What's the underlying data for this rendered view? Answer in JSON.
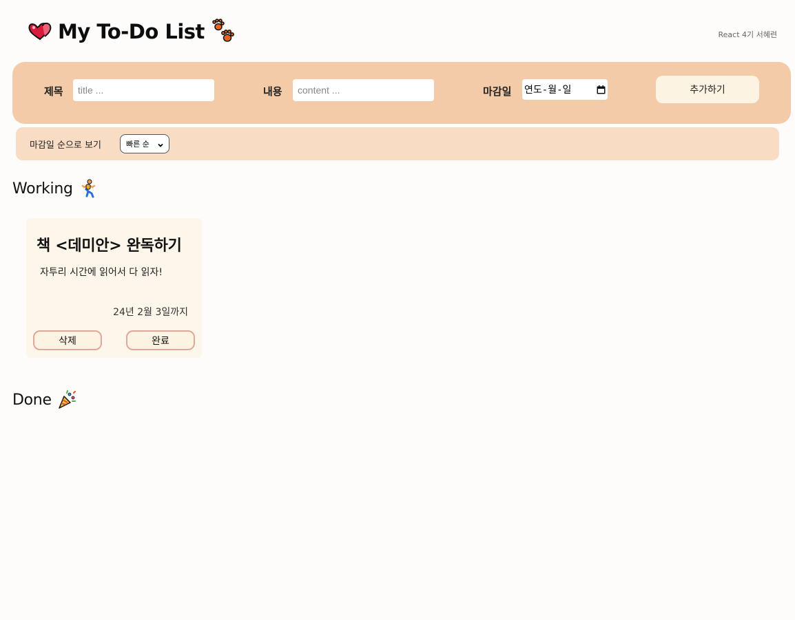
{
  "header": {
    "title": "My To-Do List",
    "author": "React 4기 서혜련",
    "icons": [
      "two-hearts-icon",
      "paw-prints-icon"
    ]
  },
  "form": {
    "title_label": "제목",
    "title_placeholder": "title ...",
    "content_label": "내용",
    "content_placeholder": "content ...",
    "deadline_label": "마감일",
    "deadline_value": "연도-월-일",
    "add_button": "추가하기"
  },
  "sort": {
    "label": "마감일 순으로 보기",
    "selected": "빠른 순"
  },
  "working": {
    "title": "Working",
    "icon": "person-running-icon",
    "cards": [
      {
        "title": "책 <데미안> 완독하기",
        "content": "자투리 시간에 읽어서 다 읽자!",
        "deadline": "24년 2월 3일까지",
        "delete_label": "삭제",
        "done_label": "완료"
      }
    ]
  },
  "done": {
    "title": "Done",
    "icon": "party-popper-icon"
  },
  "colors": {
    "background": "#fdfcfb",
    "form_bar": "#f3cba8",
    "sort_bar": "#f8dcc4",
    "card": "#fdf6ea",
    "button": "#fdf3e2",
    "button_border": "#e0a898"
  }
}
